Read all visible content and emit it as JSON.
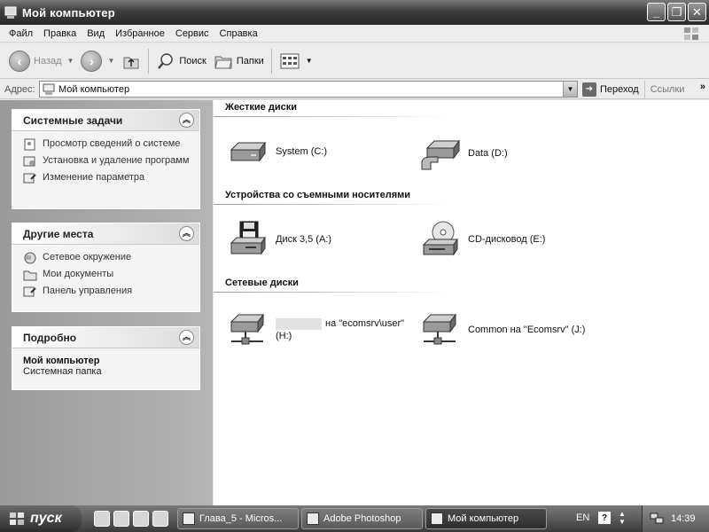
{
  "window": {
    "title": "Мой компьютер"
  },
  "menu": [
    "Файл",
    "Правка",
    "Вид",
    "Избранное",
    "Сервис",
    "Справка"
  ],
  "toolbar": {
    "back": "Назад",
    "search": "Поиск",
    "folders": "Папки"
  },
  "address": {
    "label": "Адрес:",
    "value": "Мой компьютер",
    "go": "Переход",
    "links": "Ссылки"
  },
  "tasks_panel": {
    "title": "Системные задачи",
    "items": [
      {
        "label": "Просмотр сведений о системе"
      },
      {
        "label": "Установка и удаление программ"
      },
      {
        "label": "Изменение параметра"
      }
    ]
  },
  "places_panel": {
    "title": "Другие места",
    "items": [
      {
        "label": "Сетевое окружение"
      },
      {
        "label": "Мои документы"
      },
      {
        "label": "Панель управления"
      }
    ]
  },
  "details_panel": {
    "title": "Подробно",
    "name": "Мой компьютер",
    "type": "Системная папка"
  },
  "groups": {
    "hard": {
      "title": "Жесткие диски",
      "drives": [
        {
          "label": "System (C:)"
        },
        {
          "label": "Data (D:)"
        }
      ]
    },
    "removable": {
      "title": "Устройства со съемными носителями",
      "drives": [
        {
          "label": "Диск 3,5 (A:)"
        },
        {
          "label": "CD-дисковод (E:)"
        }
      ]
    },
    "network": {
      "title": "Сетевые диски",
      "drives": [
        {
          "label1": "на \"ecomsrv\\user\"",
          "label2": "(H:)"
        },
        {
          "label": "Common на \"Ecomsrv\" (J:)"
        }
      ]
    }
  },
  "taskbar": {
    "start": "пуск",
    "tasks": [
      {
        "label": "Глава_5 - Micros..."
      },
      {
        "label": "Adobe Photoshop"
      },
      {
        "label": "Мой компьютер"
      }
    ],
    "lang": "EN",
    "clock": "14:39"
  }
}
